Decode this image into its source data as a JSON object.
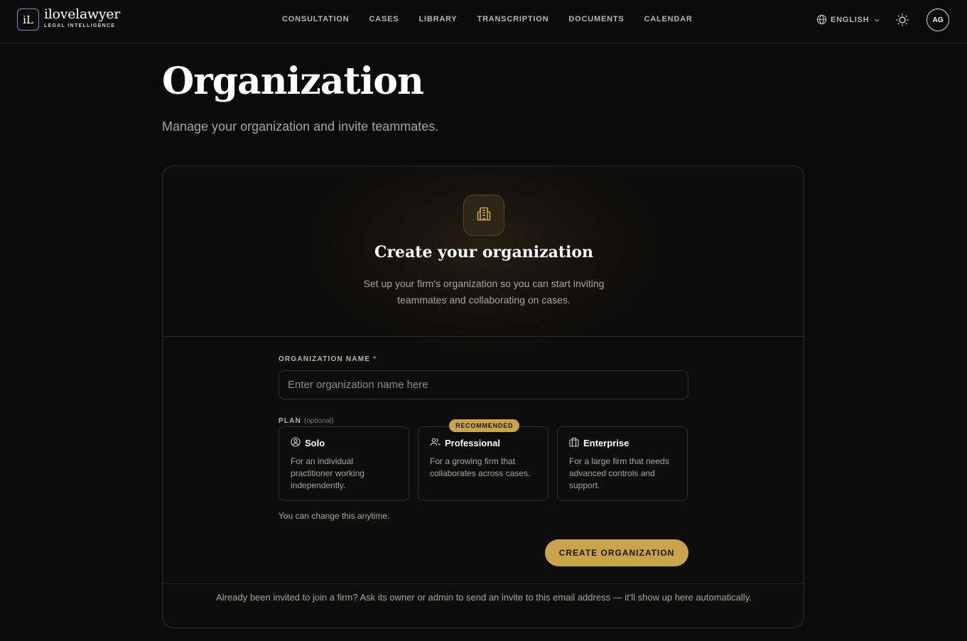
{
  "brand": {
    "mark": "iL",
    "name": "ilovelawyer",
    "tagline": "LEGAL INTELLIGENCE",
    "mark_border_color": "#8f86c9"
  },
  "nav": {
    "items": [
      "CONSULTATION",
      "CASES",
      "LIBRARY",
      "TRANSCRIPTION",
      "DOCUMENTS",
      "CALENDAR"
    ]
  },
  "header": {
    "language": "ENGLISH",
    "avatar_initials": "AG",
    "theme_icon": "sun-icon"
  },
  "page": {
    "title": "Organization",
    "subtitle": "Manage your organization and invite teammates."
  },
  "card": {
    "icon": "building-icon",
    "title": "Create your organization",
    "description": "Set up your firm's organization so you can start inviting teammates and collaborating on cases.",
    "org_name_label": "ORGANIZATION NAME",
    "required_mark": "*",
    "org_name_placeholder": "Enter organization name here",
    "org_name_value": "",
    "plan_label": "PLAN",
    "plan_optional": "(optional)",
    "plans": [
      {
        "name": "Solo",
        "icon": "user-circle-icon",
        "description": "For an individual practitioner working independently."
      },
      {
        "name": "Professional",
        "icon": "users-icon",
        "description": "For a growing firm that collaborates across cases.",
        "badge": "RECOMMENDED"
      },
      {
        "name": "Enterprise",
        "icon": "building-icon",
        "description": "For a large firm that needs advanced controls and support."
      }
    ],
    "plan_hint": "You can change this anytime.",
    "create_button": "CREATE ORGANIZATION",
    "footer_note": "Already been invited to join a firm? Ask its owner or admin to send an invite to this email address — it'll show up here automatically."
  },
  "colors": {
    "accent": "#c9a44d",
    "background": "#0b0b0b",
    "required": "#e07b2a"
  }
}
